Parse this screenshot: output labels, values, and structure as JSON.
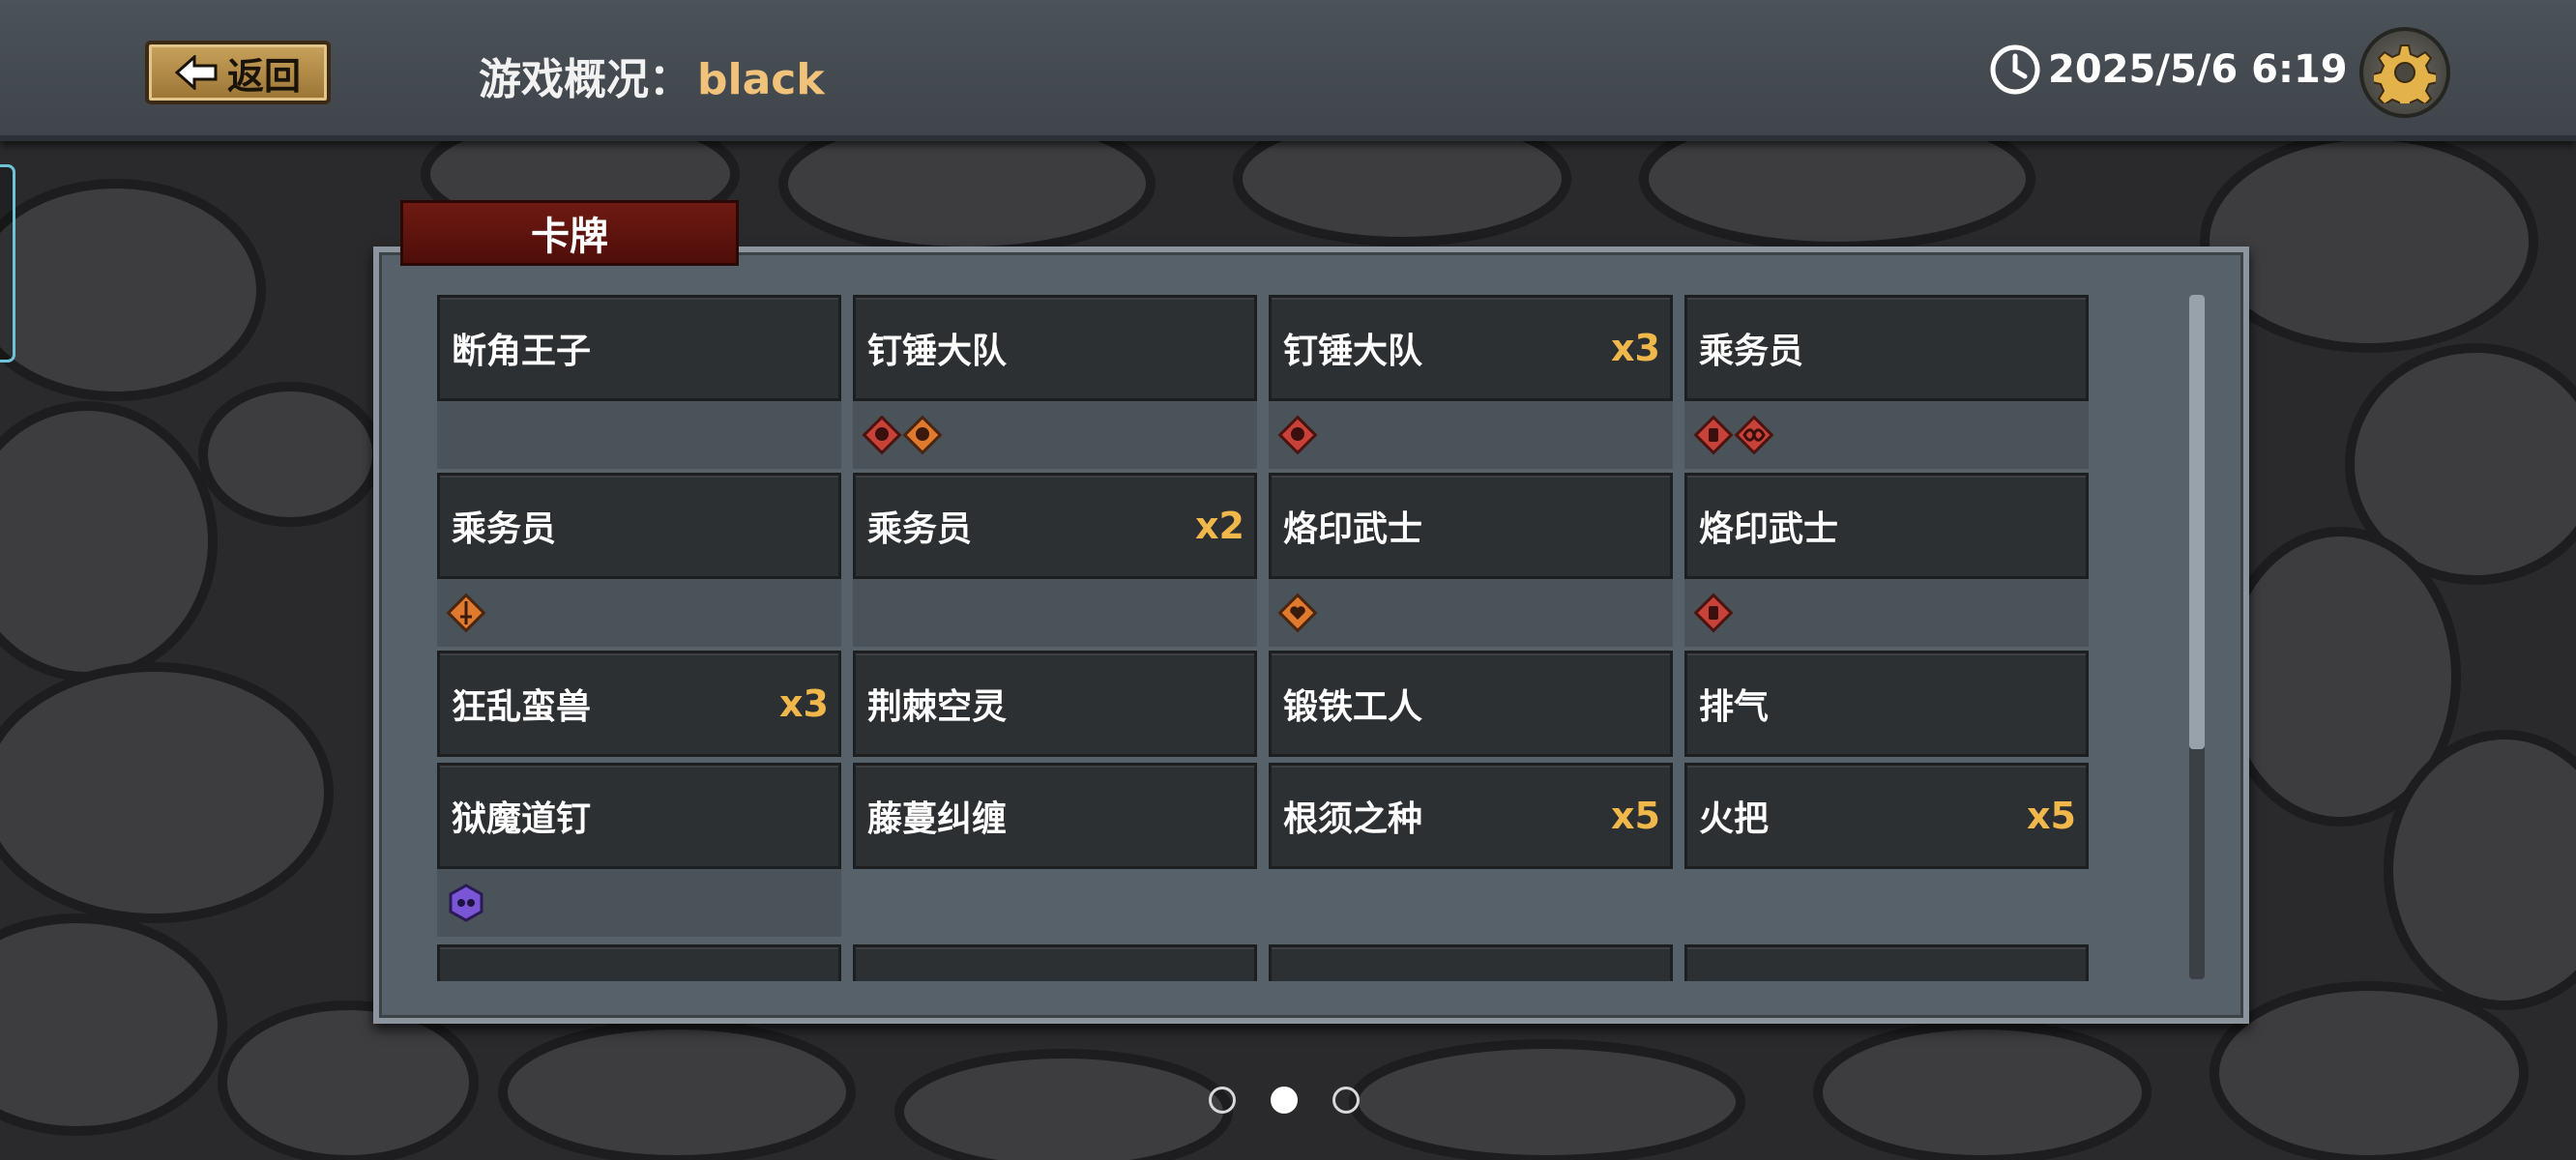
{
  "header": {
    "back_label": "返回",
    "title_prefix": "游戏概况：",
    "player_name": "black",
    "datetime": "2025/5/6 6:19"
  },
  "panel": {
    "tab_label": "卡牌"
  },
  "cards": [
    {
      "name": "断角王子",
      "count": "",
      "tags": []
    },
    {
      "name": "钉锤大队",
      "count": "",
      "tags": [
        "red-skull-tag-icon",
        "orange-skull-tag-icon"
      ]
    },
    {
      "name": "钉锤大队",
      "count": "x3",
      "tags": [
        "red-skull-tag-icon"
      ]
    },
    {
      "name": "乘务员",
      "count": "",
      "tags": [
        "red-fist-tag-icon",
        "red-infinity-tag-icon"
      ]
    },
    {
      "name": "乘务员",
      "count": "",
      "tags": [
        "orange-sword-tag-icon"
      ]
    },
    {
      "name": "乘务员",
      "count": "x2",
      "tags": []
    },
    {
      "name": "烙印武士",
      "count": "",
      "tags": [
        "orange-heart-tag-icon"
      ]
    },
    {
      "name": "烙印武士",
      "count": "",
      "tags": [
        "red-fist-tag-icon"
      ]
    },
    {
      "name": "狂乱蛮兽",
      "count": "x3",
      "tags": []
    },
    {
      "name": "荆棘空灵",
      "count": "",
      "tags": []
    },
    {
      "name": "锻铁工人",
      "count": "",
      "tags": []
    },
    {
      "name": "排气",
      "count": "",
      "tags": []
    },
    {
      "name": "狱魔道钉",
      "count": "",
      "tags": [
        "purple-hex-tag-icon"
      ]
    },
    {
      "name": "藤蔓纠缠",
      "count": "",
      "tags": []
    },
    {
      "name": "根须之种",
      "count": "x5",
      "tags": []
    },
    {
      "name": "火把",
      "count": "x5",
      "tags": []
    }
  ],
  "pagination": {
    "pages": 3,
    "current": 2
  },
  "colors": {
    "accent_gold": "#f0b84a",
    "player_name": "#f0c27a",
    "tab_red": "#6e1a12",
    "card_bg": "#2d3033"
  }
}
